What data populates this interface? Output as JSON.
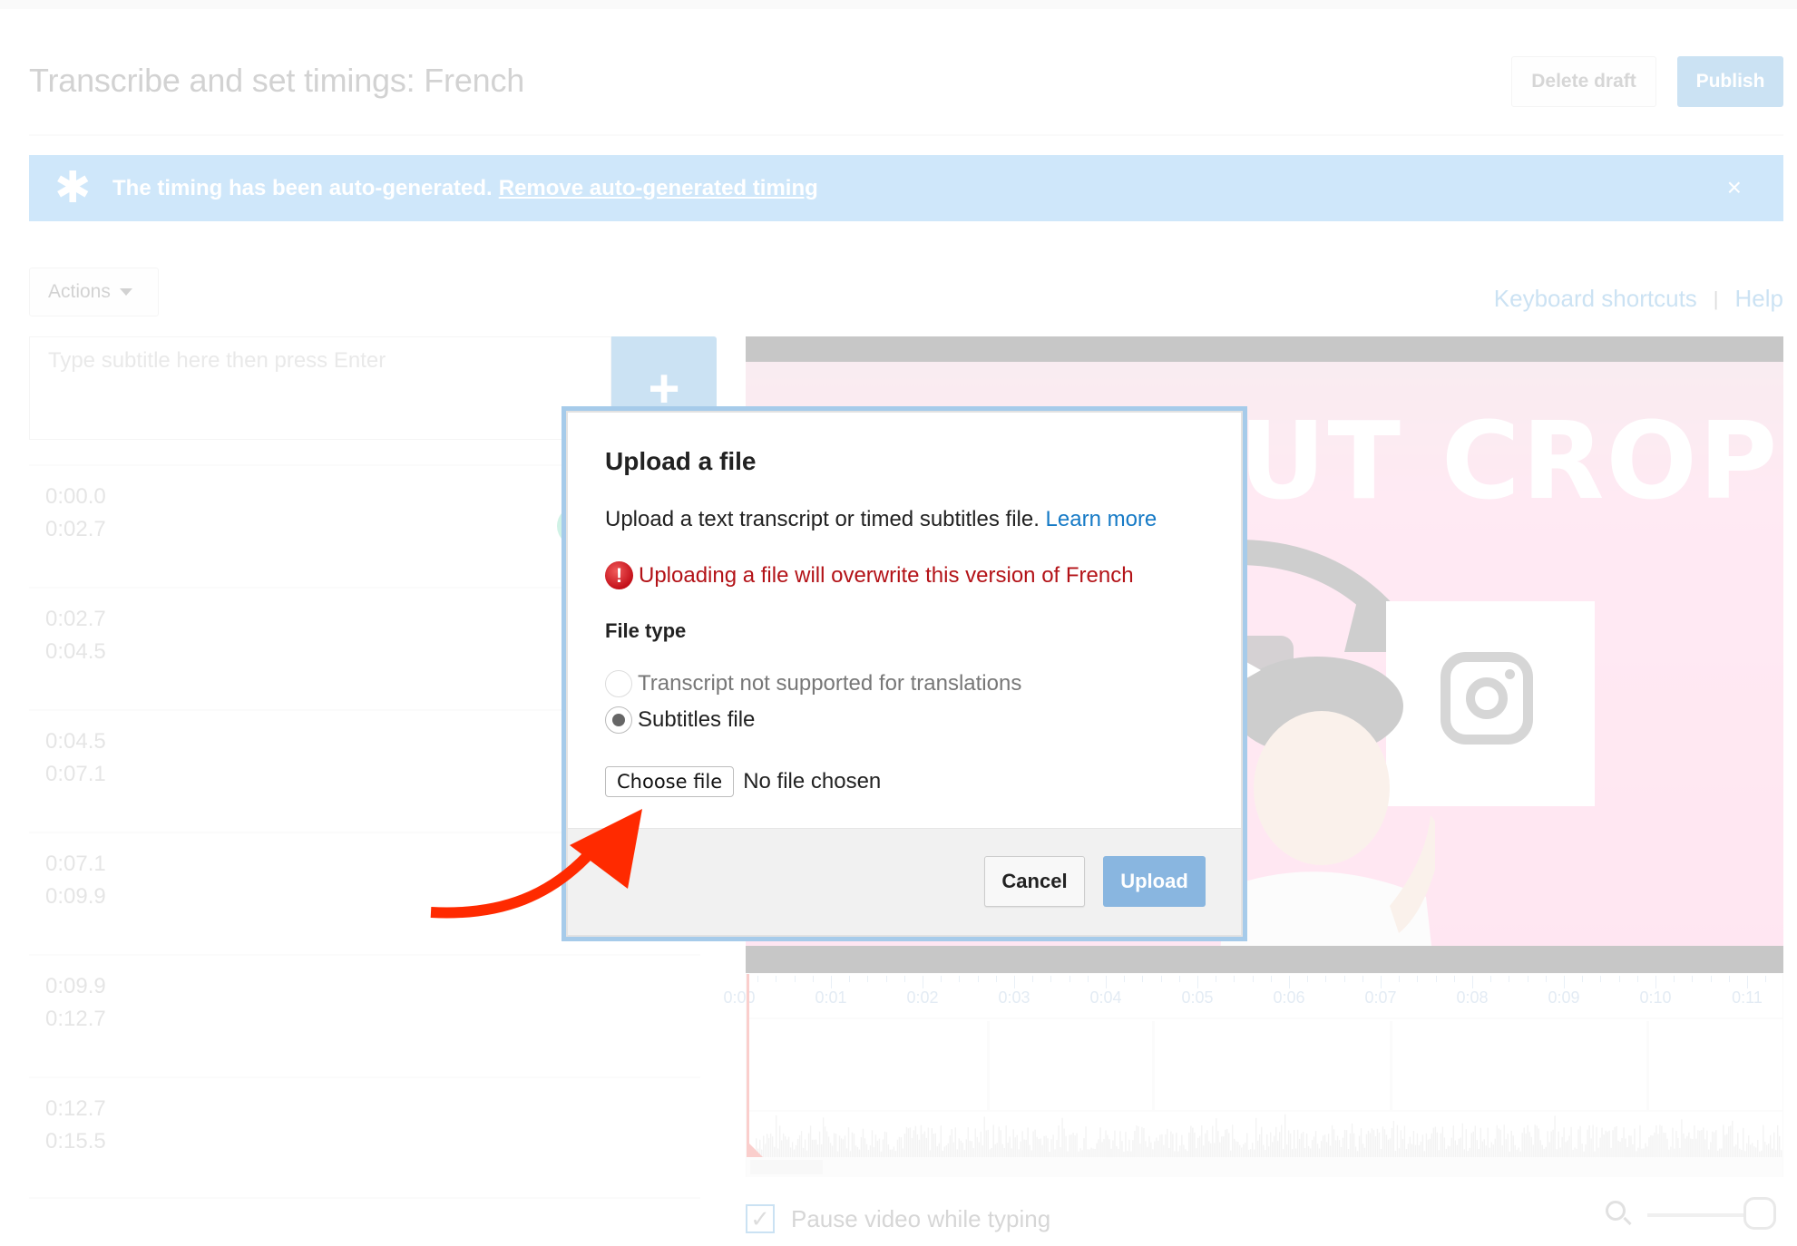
{
  "page": {
    "title": "Transcribe and set timings: French",
    "delete_draft_label": "Delete draft",
    "publish_label": "Publish"
  },
  "banner": {
    "icon": "asterisk-icon",
    "message": "The timing has been auto-generated.",
    "link_label": "Remove auto-generated timing",
    "close_glyph": "×"
  },
  "toolbar": {
    "actions_label": "Actions",
    "keyboard_shortcuts_label": "Keyboard shortcuts",
    "separator": "|",
    "help_label": "Help"
  },
  "editor": {
    "input_placeholder": "Type subtitle here then press Enter",
    "add_glyph": "+"
  },
  "subtitles": [
    {
      "start": "0:00.0",
      "end": "0:02.7"
    },
    {
      "start": "0:02.7",
      "end": "0:04.5"
    },
    {
      "start": "0:04.5",
      "end": "0:07.1"
    },
    {
      "start": "0:07.1",
      "end": "0:09.9"
    },
    {
      "start": "0:09.9",
      "end": "0:12.7"
    },
    {
      "start": "0:12.7",
      "end": "0:15.5"
    }
  ],
  "video": {
    "headline": "WITHOUT CROP"
  },
  "timeline": {
    "tick_labels": [
      "0:00",
      "0:01",
      "0:02",
      "0:03",
      "0:04",
      "0:05",
      "0:06",
      "0:07",
      "0:08",
      "0:09",
      "0:10",
      "0:11"
    ],
    "segment_boundaries_sec": [
      2.7,
      4.5,
      7.1,
      9.9
    ]
  },
  "footer": {
    "pause_label": "Pause video while typing",
    "pause_checked": true,
    "check_glyph": "✓"
  },
  "dialog": {
    "title": "Upload a file",
    "description": "Upload a text transcript or timed subtitles file.",
    "learn_more_label": "Learn more",
    "warning_glyph": "!",
    "warning": "Uploading a file will overwrite this version of French",
    "file_type_label": "File type",
    "options": [
      {
        "label": "Transcript not supported for translations",
        "selected": false,
        "disabled": true
      },
      {
        "label": "Subtitles file",
        "selected": true,
        "disabled": false
      }
    ],
    "choose_file_label": "Choose file",
    "no_file_label": "No file chosen",
    "cancel_label": "Cancel",
    "upload_label": "Upload"
  },
  "colors": {
    "accent": "#167ac6",
    "warning": "#b31217",
    "annotation_arrow": "#ff2a00"
  }
}
